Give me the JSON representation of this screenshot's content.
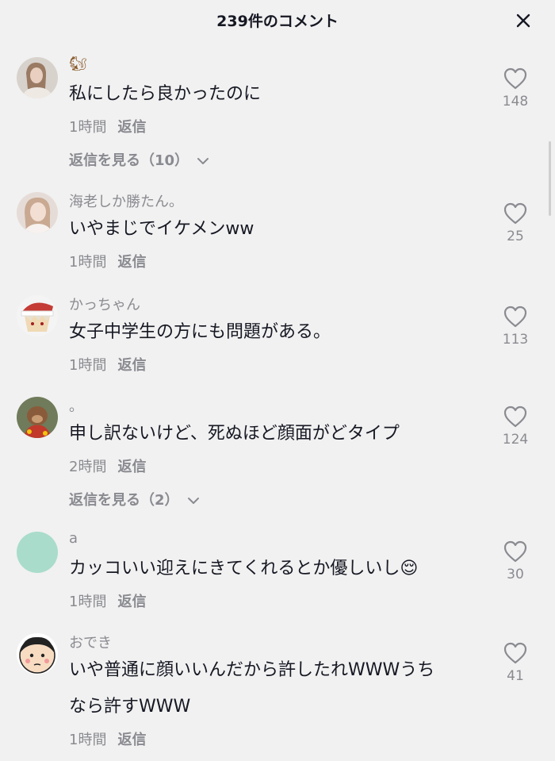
{
  "header": {
    "title": "239件のコメント"
  },
  "comments": [
    {
      "username": "",
      "username_emoji": "🐿",
      "text": "私にしたら良かったのに",
      "time": "1時間",
      "reply_label": "返信",
      "view_replies": "返信を見る（10）",
      "likes": "148",
      "avatar_icon": "avatar-photo-girl",
      "avatar_color": "#c9b7a7"
    },
    {
      "username": "海老しか勝たん。",
      "text": "いやまじでイケメンww",
      "time": "1時間",
      "reply_label": "返信",
      "likes": "25",
      "avatar_icon": "avatar-photo-girl",
      "avatar_color": "#d9c3bb"
    },
    {
      "username": "かっちゃん",
      "text": "女子中学生の方にも問題がある。",
      "time": "1時間",
      "reply_label": "返信",
      "likes": "113",
      "avatar_icon": "avatar-anime-santa-hat",
      "avatar_color": "#c53b35"
    },
    {
      "username": "。",
      "text": "申し訳ないけど、死ぬほど顔面がどタイプ",
      "time": "2時間",
      "reply_label": "返信",
      "view_replies": "返信を見る（2）",
      "likes": "124",
      "avatar_icon": "avatar-photo-dog",
      "avatar_color": "#b8453a"
    },
    {
      "username": "a",
      "text": "カッコいい迎えにきてくれるとか優しいし😌",
      "time": "1時間",
      "reply_label": "返信",
      "likes": "30",
      "avatar_icon": "avatar-plain",
      "avatar_color": "#a9dccb"
    },
    {
      "username": "おでき",
      "text": "いや普通に顔いいんだから許したれWWWうち\nなら許すWWW",
      "time": "1時間",
      "reply_label": "返信",
      "likes": "41",
      "avatar_icon": "avatar-cartoon-face",
      "avatar_color": "#f7dcc2"
    }
  ],
  "colors": {
    "background": "#f1f1f1",
    "primary_text": "#161823",
    "secondary_text": "#8a8b91"
  }
}
